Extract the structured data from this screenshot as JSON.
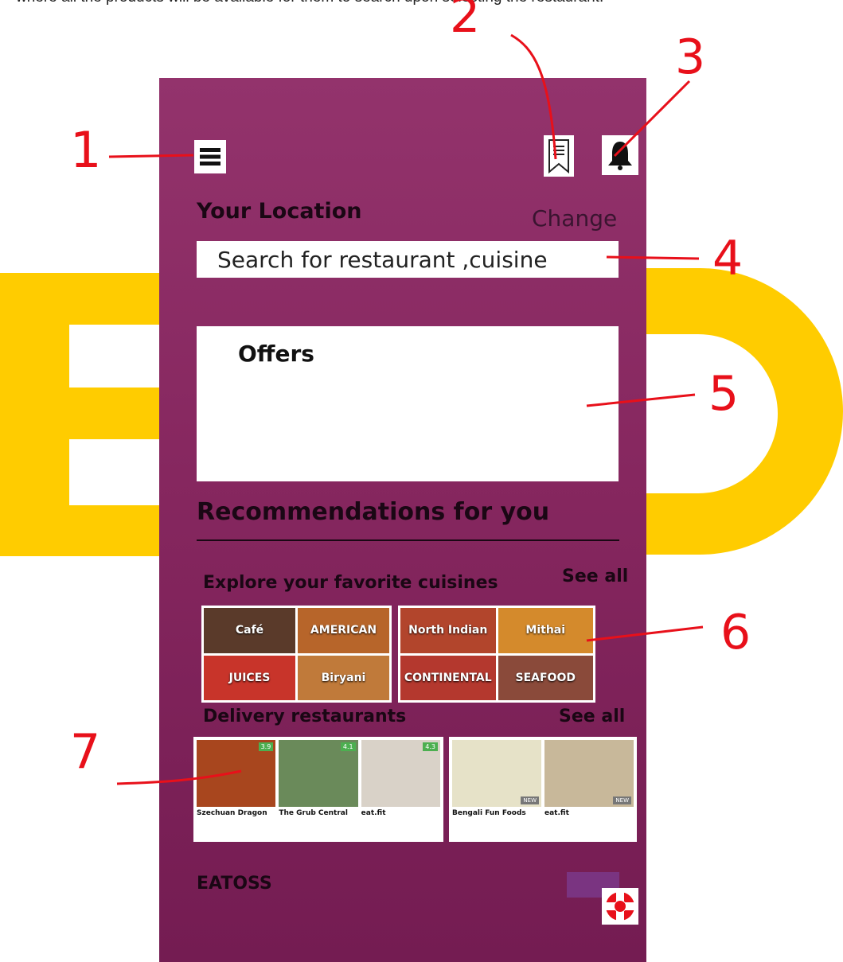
{
  "caption": "where all the products will be available for them to search upon selecting the restaurant.",
  "header": {
    "menu_icon": "hamburger-menu-icon",
    "bookmark_icon": "bookmark-icon",
    "notification_icon": "bell-icon"
  },
  "location": {
    "title": "Your Location",
    "change_label": "Change"
  },
  "search": {
    "placeholder": "Search for restaurant ,cuisine"
  },
  "offers": {
    "title": "Offers"
  },
  "recommendations": {
    "title": "Recommendations for you"
  },
  "cuisines": {
    "title": "Explore your favorite cuisines",
    "see_all": "See all",
    "tiles": [
      {
        "label": "Café",
        "color": "#5a3a2a"
      },
      {
        "label": "AMERICAN",
        "color": "#b7652a"
      },
      {
        "label": "JUICES",
        "color": "#c8342a"
      },
      {
        "label": "Biryani",
        "color": "#c07a3a"
      },
      {
        "label": "North Indian",
        "color": "#b2452c"
      },
      {
        "label": "Mithai",
        "color": "#d48a2c"
      },
      {
        "label": "CONTINENTAL",
        "color": "#b4382e"
      },
      {
        "label": "SEAFOOD",
        "color": "#8a4a3a"
      }
    ]
  },
  "delivery": {
    "title": "Delivery restaurants",
    "see_all": "See all",
    "restaurants": [
      {
        "name": "Szechuan Dragon",
        "rating": "3.9",
        "color": "#a8461e"
      },
      {
        "name": "The Grub Central",
        "rating": "4.1",
        "color": "#6a8a5a"
      },
      {
        "name": "eat.fit",
        "rating": "4.3",
        "color": "#d9d2c8"
      },
      {
        "name": "Bengali Fun Foods",
        "badge": "NEW",
        "color": "#e6e2c8"
      },
      {
        "name": "eat.fit",
        "badge": "NEW",
        "color": "#c8b89a"
      }
    ]
  },
  "footer": {
    "brand": "EATOSS",
    "support_icon": "lifebuoy-icon"
  },
  "annotations": [
    "1",
    "2",
    "3",
    "4",
    "5",
    "6",
    "7"
  ],
  "colors": {
    "background": "#8a2a63",
    "annotation": "#e8101a",
    "watermark": "#ffcc00"
  }
}
